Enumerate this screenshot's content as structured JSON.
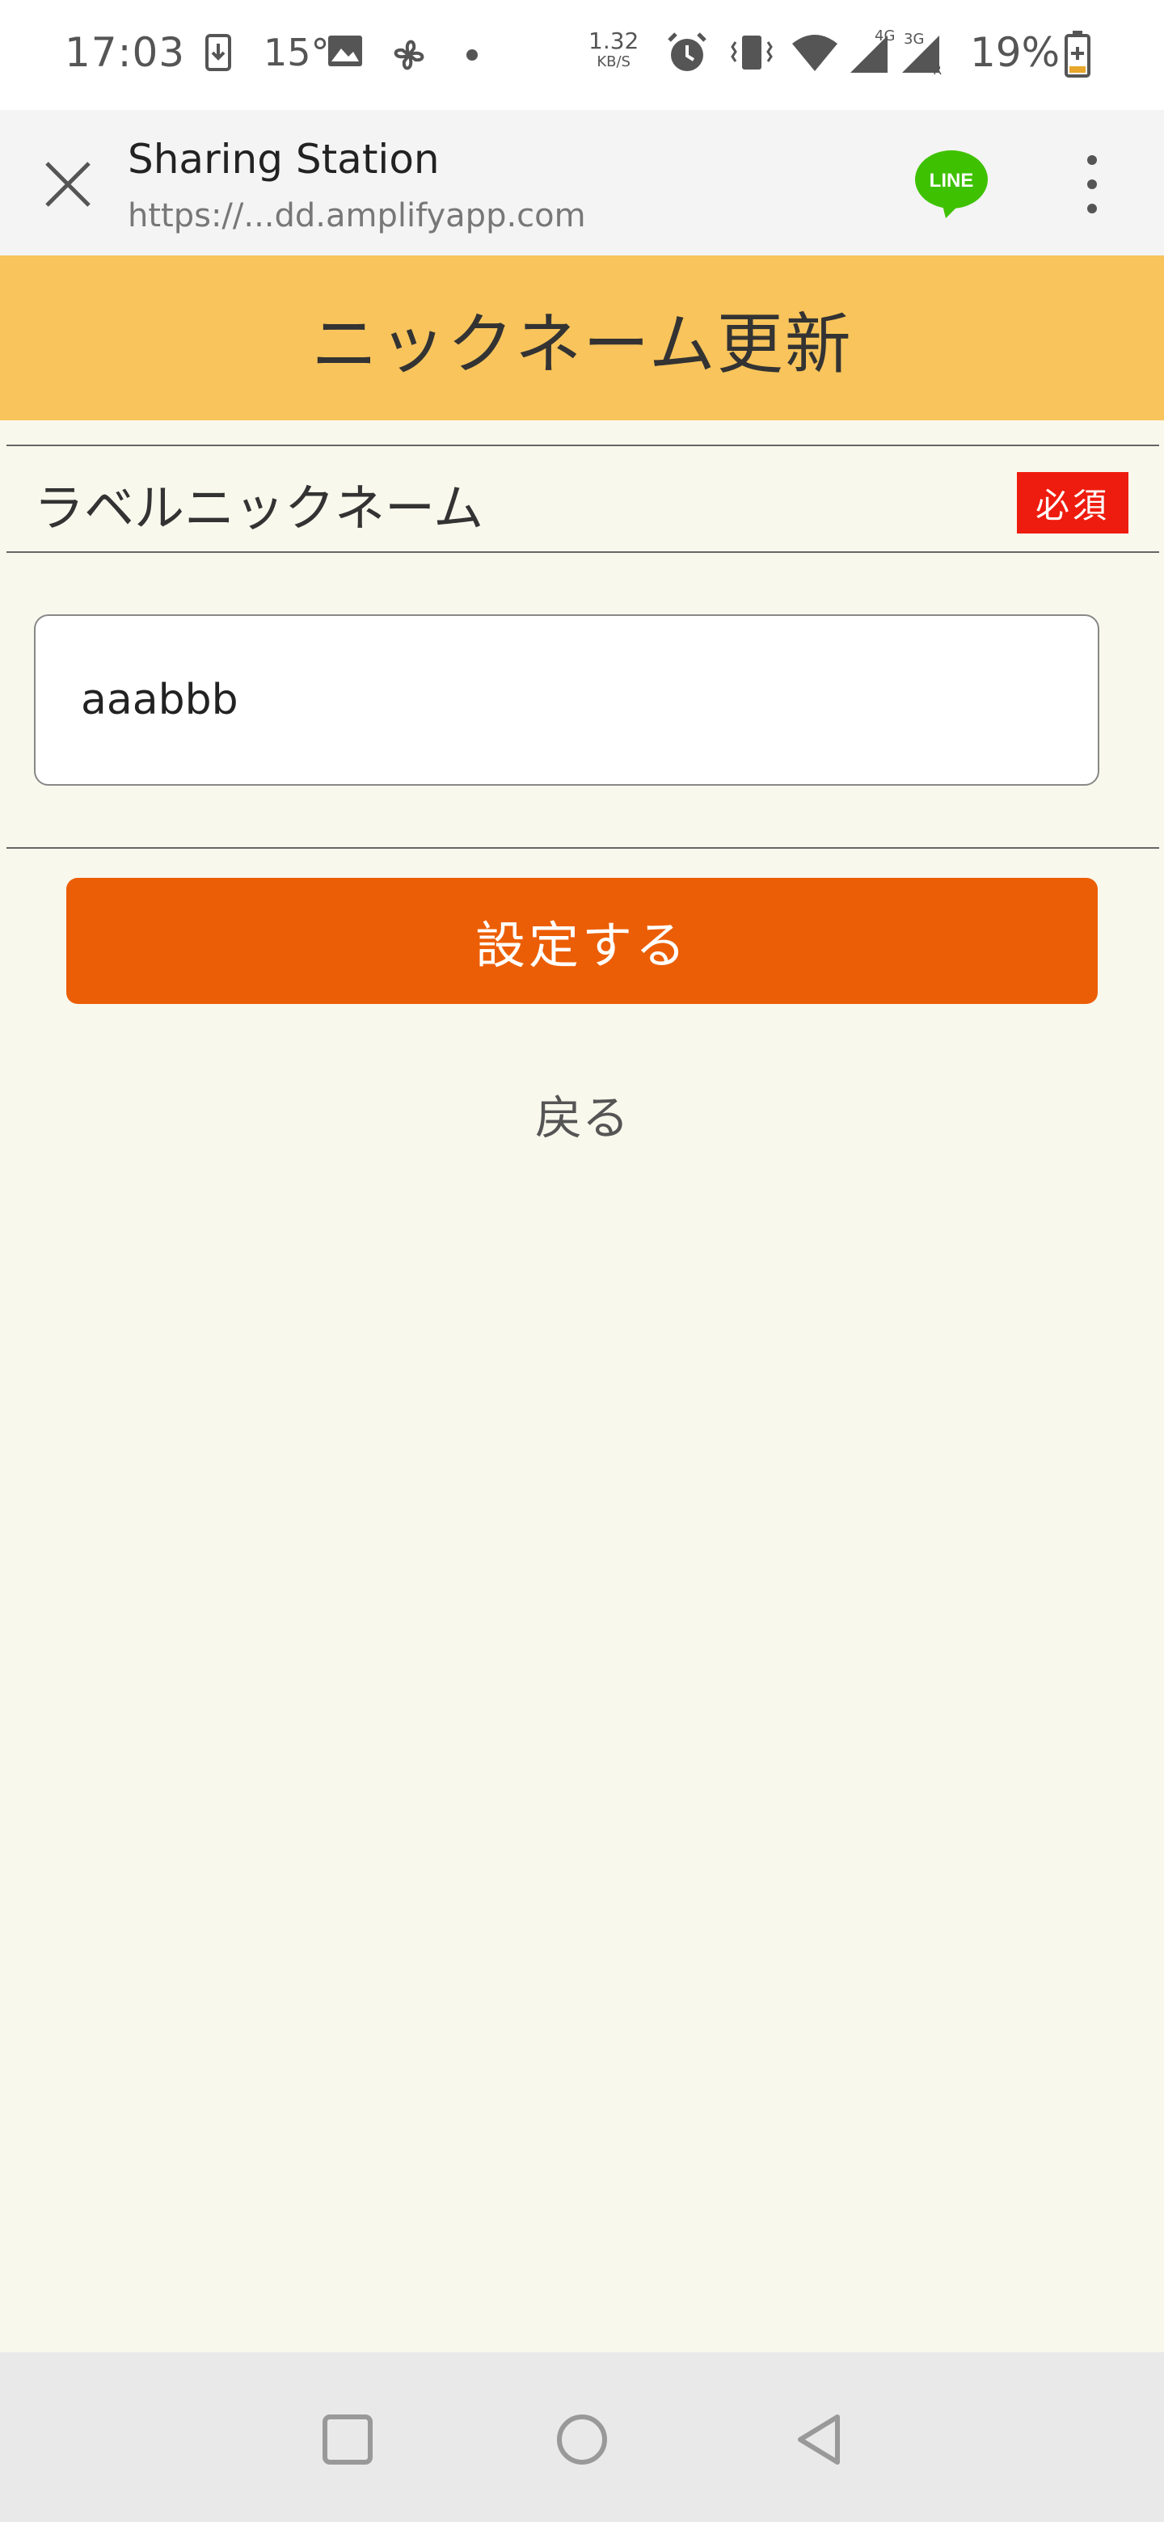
{
  "status_bar": {
    "time": "17:03",
    "temperature": "15°",
    "net_speed_value": "1.32",
    "net_speed_unit": "KB/S",
    "signal_4g": "4G+",
    "signal_3g": "3G",
    "signal_3g_sub": "R",
    "battery": "19%",
    "icons": [
      "download-icon",
      "image-icon",
      "pinwheel-icon",
      "dot-icon",
      "alarm-icon",
      "vibrate-icon",
      "wifi-icon",
      "signal-icon",
      "battery-icon"
    ]
  },
  "browser": {
    "title": "Sharing Station",
    "url": "https://...dd.amplifyapp.com",
    "line_label": "LINE",
    "colors": {
      "line_green": "#3ec100"
    }
  },
  "page": {
    "header_title": "ニックネーム更新",
    "field_label": "ラベルニックネーム",
    "required_badge": "必須",
    "nickname_value": "aaabbb",
    "submit_label": "設定する",
    "back_label": "戻る"
  },
  "colors": {
    "header_bg": "#f8c45b",
    "page_bg": "#f9f8ed",
    "submit_bg": "#ec5e05",
    "required_bg": "#ee1c0e"
  },
  "nav_bar": {
    "buttons": [
      "recent-apps-icon",
      "home-icon",
      "back-icon"
    ]
  }
}
